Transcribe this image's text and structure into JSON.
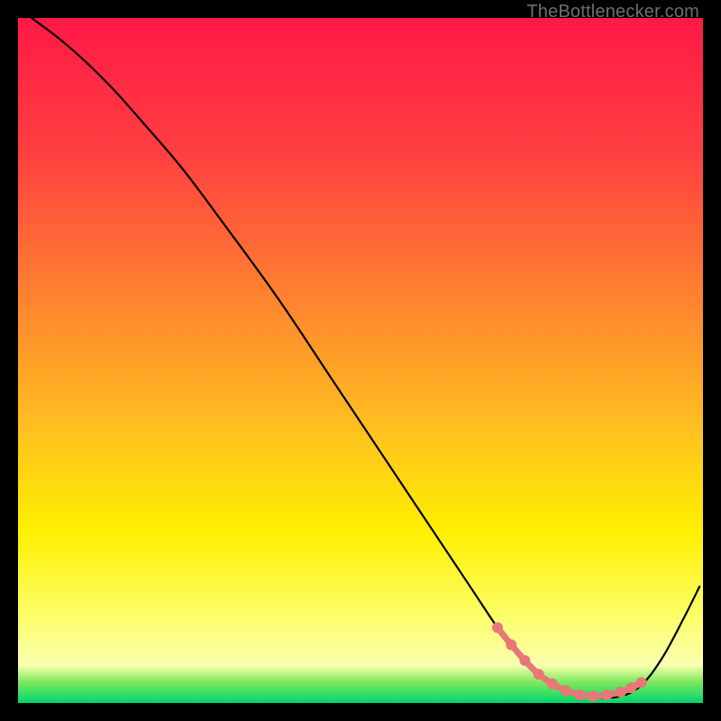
{
  "watermark": "TheBottlenecker.com",
  "chart_data": {
    "type": "line",
    "title": "",
    "xlabel": "",
    "ylabel": "",
    "xlim": [
      0,
      100
    ],
    "ylim": [
      0,
      100
    ],
    "grid": false,
    "background_gradient": {
      "stops": [
        {
          "offset": 0.0,
          "color": "#ff1946"
        },
        {
          "offset": 0.2,
          "color": "#ff4040"
        },
        {
          "offset": 0.4,
          "color": "#ff8030"
        },
        {
          "offset": 0.6,
          "color": "#ffc020"
        },
        {
          "offset": 0.75,
          "color": "#fff000"
        },
        {
          "offset": 0.88,
          "color": "#fcff70"
        },
        {
          "offset": 0.945,
          "color": "#faffb0"
        },
        {
          "offset": 0.97,
          "color": "#7be85e"
        },
        {
          "offset": 1.0,
          "color": "#00d66c"
        }
      ]
    },
    "series": [
      {
        "name": "bottleneck-curve",
        "stroke": "#000000",
        "stroke_width": 2.2,
        "x": [
          2,
          6,
          10,
          14,
          18,
          24,
          30,
          38,
          46,
          54,
          60,
          66,
          70,
          73,
          76,
          80,
          84,
          88,
          91,
          94,
          97,
          99.5
        ],
        "y": [
          100,
          97,
          93.5,
          89.5,
          85,
          78,
          70,
          59,
          47,
          35,
          26,
          17,
          11,
          7,
          4,
          1.6,
          0.8,
          1.0,
          2.6,
          6.5,
          12,
          17
        ]
      },
      {
        "name": "highlight-dots",
        "stroke": "#e87878",
        "dot_radius": 6,
        "line": true,
        "x": [
          70,
          72,
          74,
          76,
          78,
          80,
          82,
          84,
          86,
          88,
          89.5,
          91
        ],
        "y": [
          11,
          8.5,
          6.2,
          4.2,
          2.8,
          1.8,
          1.2,
          1.0,
          1.2,
          1.6,
          2.2,
          3.0
        ]
      }
    ]
  }
}
